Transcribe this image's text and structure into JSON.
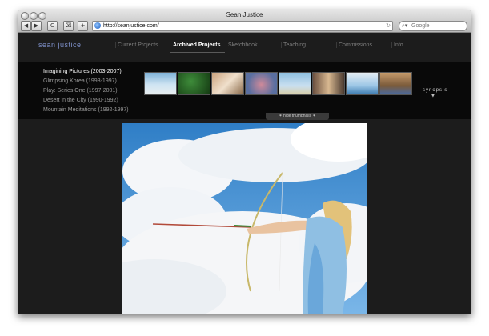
{
  "window": {
    "title": "Sean Justice",
    "url": "http://seanjustice.com/",
    "search_placeholder": "Google",
    "buttons": {
      "back": "◀",
      "forward": "▶",
      "reload": "C",
      "bookmark": "⌧",
      "add": "+"
    }
  },
  "site": {
    "logo": "sean justice",
    "nav": [
      {
        "label": "Current Projects",
        "active": false
      },
      {
        "label": "Archived Projects",
        "active": true
      },
      {
        "label": "Sketchbook",
        "active": false
      },
      {
        "label": "Teaching",
        "active": false
      },
      {
        "label": "Commissions",
        "active": false
      },
      {
        "label": "Info",
        "active": false
      }
    ],
    "projects": [
      {
        "label": "Imagining Pictures (2003-2007)",
        "active": true
      },
      {
        "label": "Glimpsing Korea (1993-1997)",
        "active": false
      },
      {
        "label": "Play: Series One (1997-2001)",
        "active": false
      },
      {
        "label": "Desert in the City (1990-1992)",
        "active": false
      },
      {
        "label": "Mountain Meditations (1992-1997)",
        "active": false
      }
    ],
    "synopsis_label": "synopsis",
    "hide_label": "✶ hide thumbnails ✶",
    "thumb_count": 8
  },
  "icons": {
    "globe": "globe-icon",
    "search": "magnifier-icon",
    "synopsis_arrow": "triangle-down-icon"
  },
  "colors": {
    "logo": "#7d8fc8",
    "background": "#1c1c1c",
    "nav_inactive": "#7e7e7e"
  }
}
